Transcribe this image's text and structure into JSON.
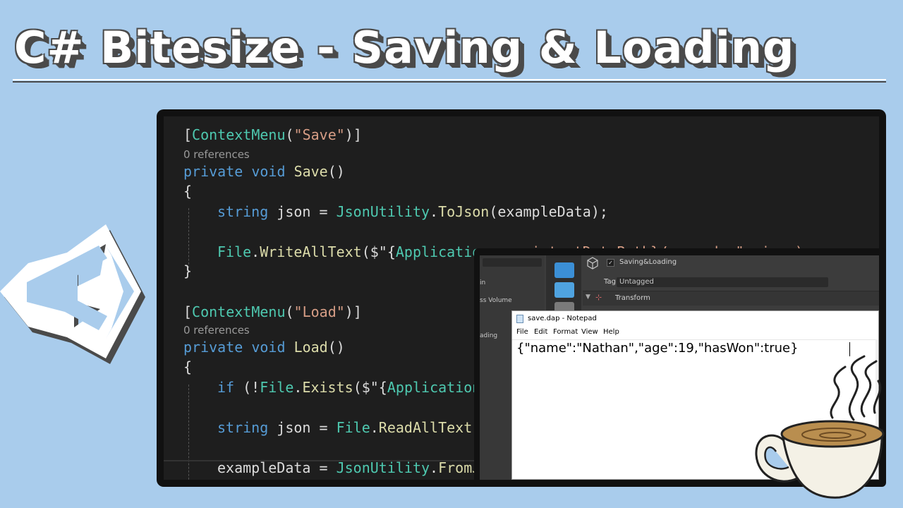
{
  "title": {
    "text": "C# Bitesize - Saving & Loading"
  },
  "code": {
    "line1": {
      "open": "[",
      "attr": "ContextMenu",
      "paren": "(",
      "str": "\"Save\"",
      "close": ")]"
    },
    "refs1": "0 references",
    "line2": {
      "kw1": "private",
      "kw2": "void",
      "name": "Save",
      "rest": "()"
    },
    "brace_open": "{",
    "line3": {
      "kw": "string",
      "var": " json = ",
      "cls": "JsonUtility",
      "dot": ".",
      "fn": "ToJson",
      "rest": "(exampleData);"
    },
    "line4": {
      "cls": "File",
      "dot": ".",
      "fn": "WriteAllText",
      "rest": "($\"{",
      "cls2": "Application",
      "rest2": ".persistentDataPath}/save.dap\", json);"
    },
    "brace_close": "}",
    "line5": {
      "open": "[",
      "attr": "ContextMenu",
      "paren": "(",
      "str": "\"Load\"",
      "close": ")]"
    },
    "refs2": "0 references",
    "line6": {
      "kw1": "private",
      "kw2": "void",
      "name": "Load",
      "rest": "()"
    },
    "line7": {
      "kw": "if",
      "rest": " (!",
      "cls": "File",
      "dot": ".",
      "fn": "Exists",
      "rest2": "($\"{",
      "cls2": "Application"
    },
    "line8": {
      "kw": "string",
      "var": " json = ",
      "cls": "File",
      "dot": ".",
      "fn": "ReadAllText",
      "rest": "("
    },
    "line9": {
      "var": "exampleData = ",
      "cls": "JsonUtility",
      "dot": ".",
      "fn": "FromJ"
    }
  },
  "unity": {
    "hierarchy_items": [
      "in",
      "ss Volume",
      "ading"
    ],
    "object_name": "Saving&Loading",
    "tag_label": "Tag",
    "tag_value": "Untagged",
    "component": "Transform"
  },
  "notepad": {
    "window_title": "save.dap - Notepad",
    "menu": [
      "File",
      "Edit",
      "Format",
      "View",
      "Help"
    ],
    "content": "{\"name\":\"Nathan\",\"age\":19,\"hasWon\":true}"
  },
  "colors": {
    "background": "#a9ccec",
    "keyword": "#569cd6",
    "type": "#4ec9b0",
    "string": "#d69d85",
    "method": "#dcdcaa"
  }
}
